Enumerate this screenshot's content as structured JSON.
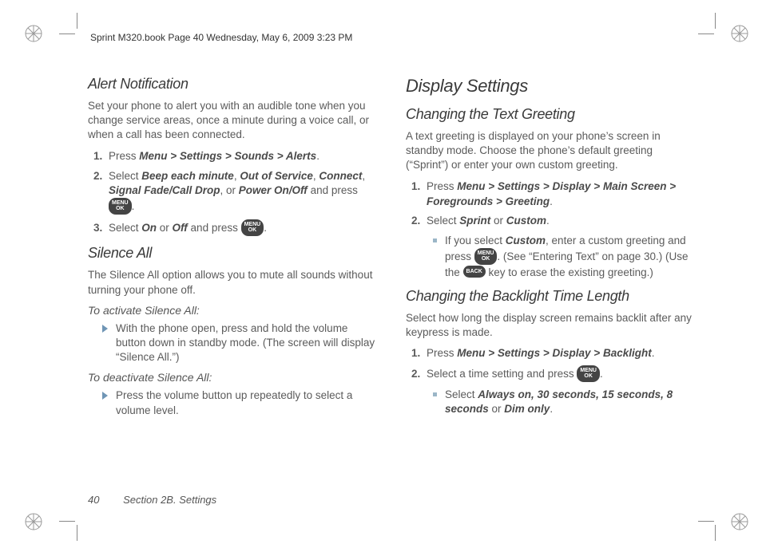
{
  "header": "Sprint M320.book  Page 40  Wednesday, May 6, 2009  3:23 PM",
  "left": {
    "alert_title": "Alert Notification",
    "alert_body": "Set your phone to alert you with an audible tone when you change service areas, once a minute during a voice call, or when a call has been connected.",
    "alert_step1_a": "Press ",
    "alert_step1_b": "Menu > Settings > Sounds > Alerts",
    "alert_step1_c": ".",
    "alert_step2_a": "Select ",
    "alert_step2_b": "Beep each minute",
    "alert_step2_c": ", ",
    "alert_step2_d": "Out of Service",
    "alert_step2_e": ", ",
    "alert_step2_f": "Connect",
    "alert_step2_g": ", ",
    "alert_step2_h": "Signal Fade/Call Drop",
    "alert_step2_i": ", or ",
    "alert_step2_j": "Power On/Off",
    "alert_step2_k": " and press ",
    "alert_step2_l": ".",
    "alert_step3_a": "Select ",
    "alert_step3_b": "On",
    "alert_step3_c": " or ",
    "alert_step3_d": "Off",
    "alert_step3_e": " and press ",
    "alert_step3_f": ".",
    "silence_title": "Silence All",
    "silence_body": "The Silence All option allows you to mute all sounds without turning your phone off.",
    "silence_act_h": "To activate Silence All:",
    "silence_act_text": "With the phone open, press and hold the volume button down in standby mode. (The screen will display “Silence All.”)",
    "silence_deact_h": "To deactivate Silence All:",
    "silence_deact_text": "Press the volume button up repeatedly to select a volume level."
  },
  "right": {
    "display_title": "Display Settings",
    "greet_title": "Changing the Text Greeting",
    "greet_body": "A text greeting is displayed on your phone’s screen in standby mode. Choose the phone’s default greeting (“Sprint”) or enter your own custom greeting.",
    "greet_step1_a": "Press ",
    "greet_step1_b": "Menu > Settings > Display > Main Screen > Foregrounds > Greeting",
    "greet_step1_c": ".",
    "greet_step2_a": "Select ",
    "greet_step2_b": "Sprint",
    "greet_step2_c": " or ",
    "greet_step2_d": "Custom",
    "greet_step2_e": ".",
    "greet_sub_a": "If you select ",
    "greet_sub_b": "Custom",
    "greet_sub_c": ", enter a custom greeting and press ",
    "greet_sub_d": ". (See “Entering Text” on page 30.) (Use the ",
    "greet_sub_e": " key to erase the existing greeting.)",
    "back_title": "Changing the Backlight Time Length",
    "back_body": "Select how long the display screen remains backlit after any keypress is made.",
    "back_step1_a": "Press ",
    "back_step1_b": "Menu > Settings > Display > Backlight",
    "back_step1_c": ".",
    "back_step2_a": "Select a time setting and press ",
    "back_step2_b": ".",
    "back_sub_a": "Select ",
    "back_sub_b": "Always on, 30 seconds, 15 seconds, 8 seconds",
    "back_sub_c": " or ",
    "back_sub_d": "Dim only",
    "back_sub_e": "."
  },
  "footer": {
    "page": "40",
    "section": "Section 2B. Settings"
  },
  "icons": {
    "menu_top": "MENU",
    "menu_bot": "OK",
    "back": "BACK"
  }
}
